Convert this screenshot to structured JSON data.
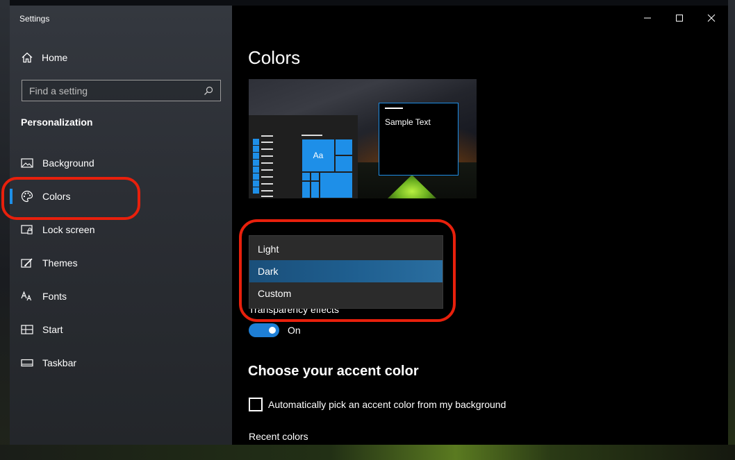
{
  "window": {
    "title": "Settings"
  },
  "sidebar": {
    "home_label": "Home",
    "search_placeholder": "Find a setting",
    "section_title": "Personalization",
    "items": [
      {
        "label": "Background",
        "icon": "image-icon"
      },
      {
        "label": "Colors",
        "icon": "palette-icon",
        "active": true
      },
      {
        "label": "Lock screen",
        "icon": "lock-screen-icon"
      },
      {
        "label": "Themes",
        "icon": "brush-icon"
      },
      {
        "label": "Fonts",
        "icon": "font-icon"
      },
      {
        "label": "Start",
        "icon": "start-icon"
      },
      {
        "label": "Taskbar",
        "icon": "taskbar-icon"
      }
    ]
  },
  "main": {
    "title": "Colors",
    "preview": {
      "tile_label": "Aa",
      "sample_text": "Sample Text"
    },
    "color_mode": {
      "options": [
        "Light",
        "Dark",
        "Custom"
      ],
      "selected": "Dark"
    },
    "transparency": {
      "label": "Transparency effects",
      "state": "On",
      "on": true
    },
    "accent_heading": "Choose your accent color",
    "auto_pick_label": "Automatically pick an accent color from my background",
    "recent_colors_label": "Recent colors"
  },
  "colors": {
    "accent": "#1e8fe8",
    "annotation": "#e8200c",
    "selected_option": "#1f5f90"
  }
}
